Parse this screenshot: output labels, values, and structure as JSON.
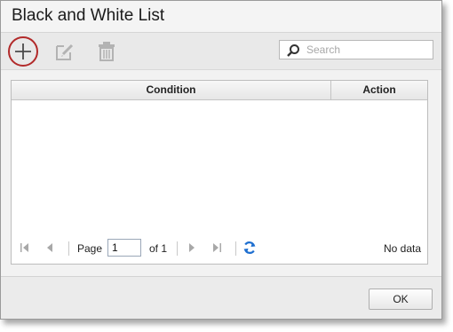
{
  "window": {
    "title": "Black and White List"
  },
  "toolbar": {
    "add_icon": "plus-icon",
    "edit_icon": "edit-icon",
    "delete_icon": "trash-icon",
    "highlight_color": "#b22a2a",
    "search": {
      "placeholder": "Search",
      "value": "",
      "icon": "magnifier-icon"
    }
  },
  "grid": {
    "columns": [
      "Condition",
      "Action"
    ],
    "rows": []
  },
  "pager": {
    "page_label": "Page",
    "current_page": "1",
    "of_label": "of 1",
    "status": "No data",
    "refresh_color": "#1e6fd0"
  },
  "footer": {
    "ok_label": "OK"
  }
}
